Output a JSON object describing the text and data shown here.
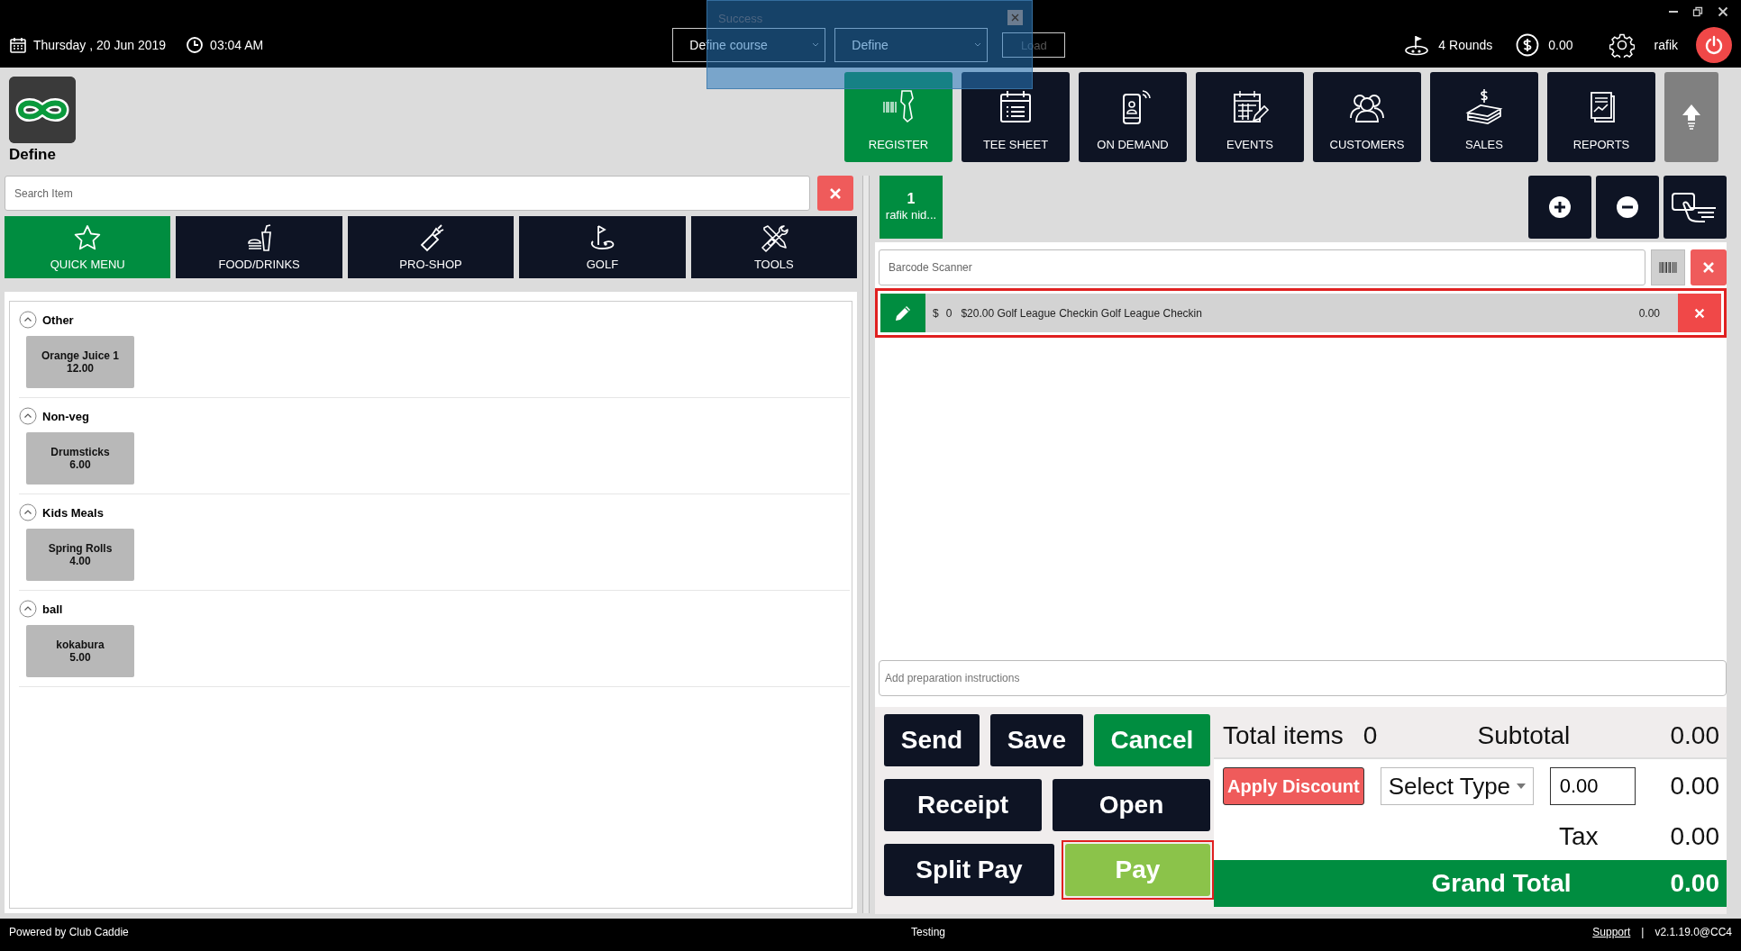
{
  "top_bar": {
    "date": "Thursday ,  20 Jun 2019",
    "time": "03:04 AM",
    "course_select": "Define course",
    "facility_select": "Define",
    "load_button": {
      "label": "Load",
      "disabled": true
    },
    "rounds": "4 Rounds",
    "balance": "0.00",
    "user": "rafik"
  },
  "toast": {
    "message": "Success"
  },
  "brand": {
    "name": "Define"
  },
  "nav": [
    {
      "label": "REGISTER",
      "kind": "register",
      "selected": true
    },
    {
      "label": "TEE SHEET",
      "kind": "teesheet",
      "selected": false
    },
    {
      "label": "ON DEMAND",
      "kind": "ondemand",
      "selected": false
    },
    {
      "label": "EVENTS",
      "kind": "events",
      "selected": false
    },
    {
      "label": "CUSTOMERS",
      "kind": "customers",
      "selected": false
    },
    {
      "label": "SALES",
      "kind": "sales",
      "selected": false
    },
    {
      "label": "REPORTS",
      "kind": "reports",
      "selected": false
    }
  ],
  "search": {
    "placeholder": "Search Item"
  },
  "categories": [
    {
      "label": "QUICK MENU",
      "kind": "star",
      "selected": true
    },
    {
      "label": "FOOD/DRINKS",
      "kind": "food",
      "selected": false
    },
    {
      "label": "PRO-SHOP",
      "kind": "proshop",
      "selected": false
    },
    {
      "label": "GOLF",
      "kind": "golf",
      "selected": false
    },
    {
      "label": "TOOLS",
      "kind": "tools",
      "selected": false
    }
  ],
  "menu_groups": [
    {
      "title": "Other",
      "expanded": true,
      "items": [
        {
          "name": "Orange Juice 1",
          "price": "12.00"
        }
      ]
    },
    {
      "title": "Non-veg",
      "expanded": true,
      "items": [
        {
          "name": "Drumsticks",
          "price": "6.00"
        }
      ]
    },
    {
      "title": "Kids Meals",
      "expanded": true,
      "items": [
        {
          "name": "Spring Rolls",
          "price": "4.00"
        }
      ]
    },
    {
      "title": "ball",
      "expanded": true,
      "items": [
        {
          "name": "kokabura",
          "price": "5.00"
        }
      ]
    }
  ],
  "tickets": [
    {
      "number": "1",
      "customer": "rafik nid...",
      "selected": true
    }
  ],
  "barcode": {
    "placeholder": "Barcode Scanner"
  },
  "order_lines": [
    {
      "currency": "$",
      "quantity": "0",
      "description": "$20.00 Golf League Checkin Golf League Checkin",
      "amount": "0.00",
      "highlighted": true
    }
  ],
  "instructions": {
    "placeholder": "Add preparation instructions"
  },
  "action_rows": [
    [
      {
        "label": "Send",
        "kind": "dark",
        "highlighted": false
      },
      {
        "label": "Save",
        "kind": "dark",
        "highlighted": false
      },
      {
        "label": "Cancel",
        "kind": "green",
        "highlighted": false
      }
    ],
    [
      {
        "label": "Receipt",
        "kind": "dark",
        "highlighted": false
      },
      {
        "label": "Open",
        "kind": "dark",
        "highlighted": false
      }
    ],
    [
      {
        "label": "Split Pay",
        "kind": "dark",
        "highlighted": false
      },
      {
        "label": "Pay",
        "kind": "lightgreen",
        "highlighted": true
      }
    ]
  ],
  "totals": {
    "items_label": "Total items",
    "items_count": "0",
    "subtotal_label": "Subtotal",
    "subtotal": "0.00",
    "discount_button": "Apply Discount",
    "discount_type": "Select Type",
    "discount_value": "0.00",
    "discount_amount": "0.00",
    "tax_label": "Tax",
    "tax": "0.00",
    "grand_total_label": "Grand Total",
    "grand_total": "0.00"
  },
  "status_bar": {
    "powered_by": "Powered by Club Caddie",
    "environment": "Testing",
    "support_link": "Support",
    "separator": "|",
    "version": "v2.1.19.0@CC4"
  }
}
